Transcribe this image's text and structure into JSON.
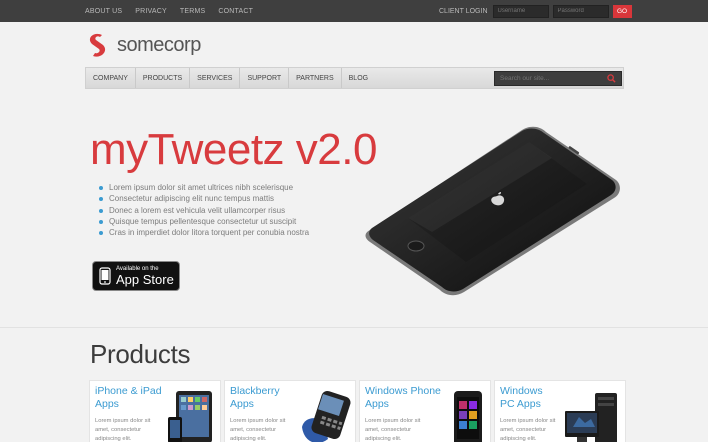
{
  "topbar": {
    "links": [
      "ABOUT US",
      "PRIVACY",
      "TERMS",
      "CONTACT"
    ],
    "client_login_label": "CLIENT LOGIN",
    "username_placeholder": "Username",
    "password_placeholder": "Password",
    "go_label": "GO"
  },
  "logo": {
    "text": "somecorp",
    "brand_color": "#d83b3e"
  },
  "nav": {
    "items": [
      "COMPANY",
      "PRODUCTS",
      "SERVICES",
      "SUPPORT",
      "PARTNERS",
      "BLOG"
    ],
    "search_placeholder": "Search our site..."
  },
  "hero": {
    "title": "myTweetz v2.0",
    "bullets": [
      "Lorem ipsum dolor sit amet ultrices nibh scelerisque",
      "Consectetur adipiscing elit nunc tempus mattis",
      "Donec a lorem est vehicula velit ullamcorper risus",
      "Quisque tempus pellentesque consectetur ut suscipit",
      "Cras in imperdiet dolor litora torquent per conubia nostra"
    ],
    "appstore_small": "Available on the",
    "appstore_big": "App Store"
  },
  "products": {
    "title": "Products",
    "cards": [
      {
        "title_line1": "iPhone & iPad",
        "title_line2": "Apps",
        "desc": "Lorem ipsum dolor sit amet, consectetur adipiscing elit."
      },
      {
        "title_line1": "Blackberry",
        "title_line2": "Apps",
        "desc": "Lorem ipsum dolor sit amet, consectetur adipiscing elit."
      },
      {
        "title_line1": "Windows Phone",
        "title_line2": "Apps",
        "desc": "Lorem ipsum dolor sit amet, consectetur adipiscing elit."
      },
      {
        "title_line1": "Windows",
        "title_line2": "PC Apps",
        "desc": "Lorem ipsum dolor sit amet, consectetur adipiscing elit."
      }
    ]
  },
  "colors": {
    "accent_red": "#d83b3e",
    "link_blue": "#3b9bd1",
    "topbar_bg": "#3f3f3f"
  }
}
